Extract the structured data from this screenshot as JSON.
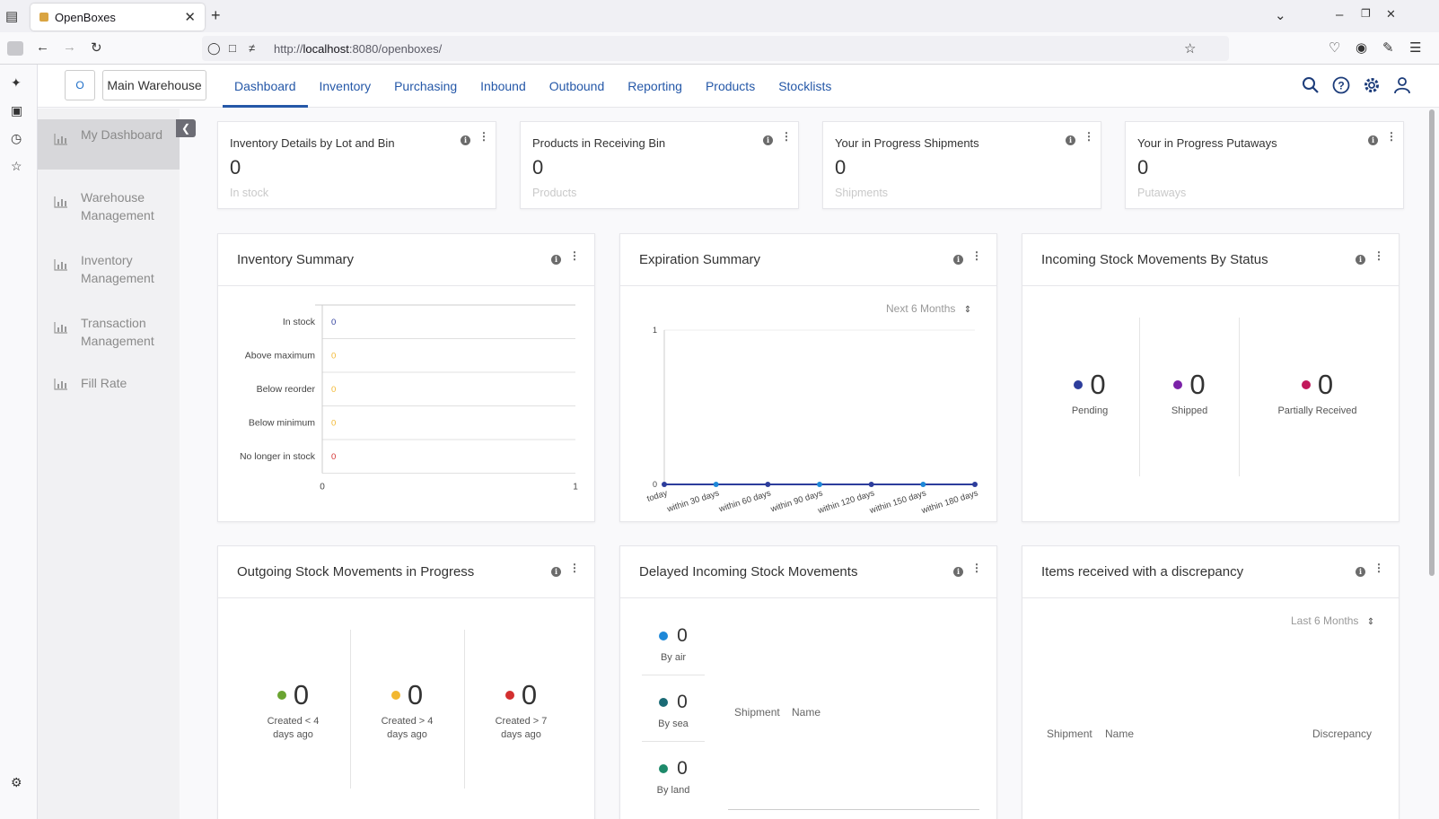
{
  "browser": {
    "tab_title": "OpenBoxes",
    "url_prefix": "http://",
    "url_host": "localhost",
    "url_rest": ":8080/openboxes/"
  },
  "header": {
    "logo_text": "O",
    "location": "Main Warehouse",
    "nav": [
      "Dashboard",
      "Inventory",
      "Purchasing",
      "Inbound",
      "Outbound",
      "Reporting",
      "Products",
      "Stocklists"
    ],
    "active_nav": "Dashboard",
    "icons": [
      "search-icon",
      "help-icon",
      "settings-icon",
      "user-icon"
    ]
  },
  "sidebar": {
    "items": [
      {
        "label": "My Dashboard",
        "active": true
      },
      {
        "label": "Warehouse Management"
      },
      {
        "label": "Inventory Management"
      },
      {
        "label": "Transaction Management"
      },
      {
        "label": "Fill Rate"
      }
    ]
  },
  "summary_cards": [
    {
      "title": "Inventory Details by Lot and Bin",
      "value": "0",
      "sub": "In stock"
    },
    {
      "title": "Products in Receiving Bin",
      "value": "0",
      "sub": "Products"
    },
    {
      "title": "Your in Progress Shipments",
      "value": "0",
      "sub": "Shipments"
    },
    {
      "title": "Your in Progress Putaways",
      "value": "0",
      "sub": "Putaways"
    }
  ],
  "inventory_summary": {
    "title": "Inventory Summary"
  },
  "expiration_summary": {
    "title": "Expiration Summary",
    "dropdown": "Next 6 Months"
  },
  "incoming_status": {
    "title": "Incoming Stock Movements By Status",
    "items": [
      {
        "value": "0",
        "label": "Pending",
        "color": "#2d3d9c"
      },
      {
        "value": "0",
        "label": "Shipped",
        "color": "#7b22a8"
      },
      {
        "value": "0",
        "label": "Partially Received",
        "color": "#c2185b"
      }
    ]
  },
  "outgoing": {
    "title": "Outgoing Stock Movements in Progress",
    "items": [
      {
        "value": "0",
        "label1": "Created < 4",
        "label2": "days ago",
        "color": "#6aa431"
      },
      {
        "value": "0",
        "label1": "Created > 4",
        "label2": "days ago",
        "color": "#f2b730"
      },
      {
        "value": "0",
        "label1": "Created > 7",
        "label2": "days ago",
        "color": "#d32f2f"
      }
    ]
  },
  "delayed": {
    "title": "Delayed Incoming Stock Movements",
    "items": [
      {
        "value": "0",
        "label": "By air",
        "color": "#1e88d8"
      },
      {
        "value": "0",
        "label": "By sea",
        "color": "#1a6a75"
      },
      {
        "value": "0",
        "label": "By land",
        "color": "#1e8a6a"
      }
    ],
    "columns": [
      "Shipment",
      "Name"
    ]
  },
  "discrepancy": {
    "title": "Items received with a discrepancy",
    "dropdown": "Last 6 Months",
    "columns": [
      "Shipment",
      "Name",
      "Discrepancy"
    ]
  },
  "chart_data": [
    {
      "type": "bar",
      "orientation": "horizontal",
      "title": "Inventory Summary",
      "categories": [
        "In stock",
        "Above maximum",
        "Below reorder",
        "Below minimum",
        "No longer in stock"
      ],
      "values": [
        0,
        0,
        0,
        0,
        0
      ],
      "label_colors": [
        "#2d3d9c",
        "#f2b730",
        "#f2b730",
        "#f2b730",
        "#d32f2f"
      ],
      "xlim": [
        0,
        1
      ],
      "xticks": [
        "0",
        "1"
      ],
      "grid": true
    },
    {
      "type": "line",
      "title": "Expiration Summary",
      "x": [
        "today",
        "within 30 days",
        "within 60 days",
        "within 90 days",
        "within 120 days",
        "within 150 days",
        "within 180 days"
      ],
      "series": [
        {
          "values": [
            0,
            0,
            0,
            0,
            0,
            0,
            0
          ]
        }
      ],
      "ylim": [
        0,
        1
      ],
      "yticks": [
        "0",
        "1"
      ],
      "colors": [
        "#2d3d9c",
        "#1e88d8"
      ]
    }
  ]
}
